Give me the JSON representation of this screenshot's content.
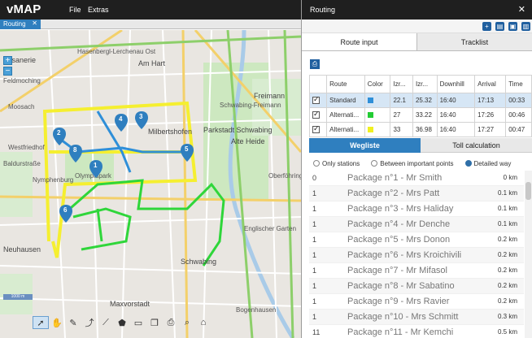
{
  "app": {
    "logo": "vMAP",
    "menu": [
      "File",
      "Extras"
    ]
  },
  "map_tab": {
    "label": "Routing",
    "close": "✕"
  },
  "map": {
    "labels": [
      "Hasenbergl-Lerchenau Ost",
      "Am Hart",
      "Fasanerie",
      "Feldmoching",
      "Milbertshofen",
      "Freimann",
      "Schwabing-Freimann",
      "Parkstadt Schwabing",
      "Alte Heide",
      "Nymphenburg",
      "Schwabing",
      "Oberföhring",
      "Neuhausen",
      "Maxvorstadt",
      "Englischer Garten",
      "Moosach",
      "Olympiapark",
      "Bogenhausen",
      "Westfriedhof",
      "Baldurstraße"
    ],
    "pins": [
      "1",
      "2",
      "3",
      "4",
      "5",
      "6",
      "8"
    ],
    "scale": "1000 m",
    "zoom_in": "+",
    "zoom_out": "−"
  },
  "panel": {
    "title": "Routing",
    "close": "✕",
    "tabs": {
      "route_input": "Route input",
      "tracklist": "Tracklist"
    },
    "routes_table": {
      "headers": [
        "",
        "Route",
        "Color",
        "Izr...",
        "Izr...",
        "Downhill",
        "Arrival",
        "Time"
      ],
      "rows": [
        {
          "checked": true,
          "route": "Standard",
          "color": "#2f8fd8",
          "c1": "22.1",
          "c2": "25.32",
          "downhill": "16:40",
          "arrival": "17:13",
          "time": "00:33"
        },
        {
          "checked": true,
          "route": "Alternati...",
          "color": "#22cc33",
          "c1": "27",
          "c2": "33.22",
          "downhill": "16:40",
          "arrival": "17:26",
          "time": "00:46"
        },
        {
          "checked": true,
          "route": "Alternati...",
          "color": "#f0f020",
          "c1": "33",
          "c2": "36.98",
          "downhill": "16:40",
          "arrival": "17:27",
          "time": "00:47"
        }
      ]
    },
    "subtabs": {
      "wegliste": "Wegliste",
      "toll": "Toll calculation"
    },
    "radios": {
      "only_stations": "Only stations",
      "between": "Between important points",
      "detailed": "Detailed way"
    },
    "waylist": [
      {
        "idx": "0",
        "name": "Package n°1 - Mr Smith",
        "dist": "0 km"
      },
      {
        "idx": "1",
        "name": "Package n°2 - Mrs Patt",
        "dist": "0.1 km"
      },
      {
        "idx": "1",
        "name": "Package n°3 - Mrs Haliday",
        "dist": "0.1 km"
      },
      {
        "idx": "1",
        "name": "Package n°4 - Mr Denche",
        "dist": "0.1 km"
      },
      {
        "idx": "1",
        "name": "Package n°5 - Mrs Donon",
        "dist": "0.2 km"
      },
      {
        "idx": "1",
        "name": "Package n°6 - Mrs Kroichivili",
        "dist": "0.2 km"
      },
      {
        "idx": "1",
        "name": "Package n°7 - Mr Mifasol",
        "dist": "0.2 km"
      },
      {
        "idx": "1",
        "name": "Package n°8 - Mr Sabatino",
        "dist": "0.2 km"
      },
      {
        "idx": "1",
        "name": "Package n°9 - Mrs Ravier",
        "dist": "0.2 km"
      },
      {
        "idx": "1",
        "name": "Package n°10 - Mrs Schmitt",
        "dist": "0.3 km"
      },
      {
        "idx": "11",
        "name": "Package n°11 -  Mr Kemchi",
        "dist": "0.5 km"
      }
    ]
  },
  "colors": {
    "accent": "#2f7fbf",
    "topbar": "#1f1f1f",
    "pin": "#2f7fbf"
  },
  "toolbar_icons": [
    "pointer-icon",
    "hand-icon",
    "draw-line-icon",
    "node-edit-icon",
    "vertex-icon",
    "polygon-icon",
    "layer-icon",
    "copy-icon",
    "print-icon",
    "search-icon",
    "home-icon"
  ]
}
